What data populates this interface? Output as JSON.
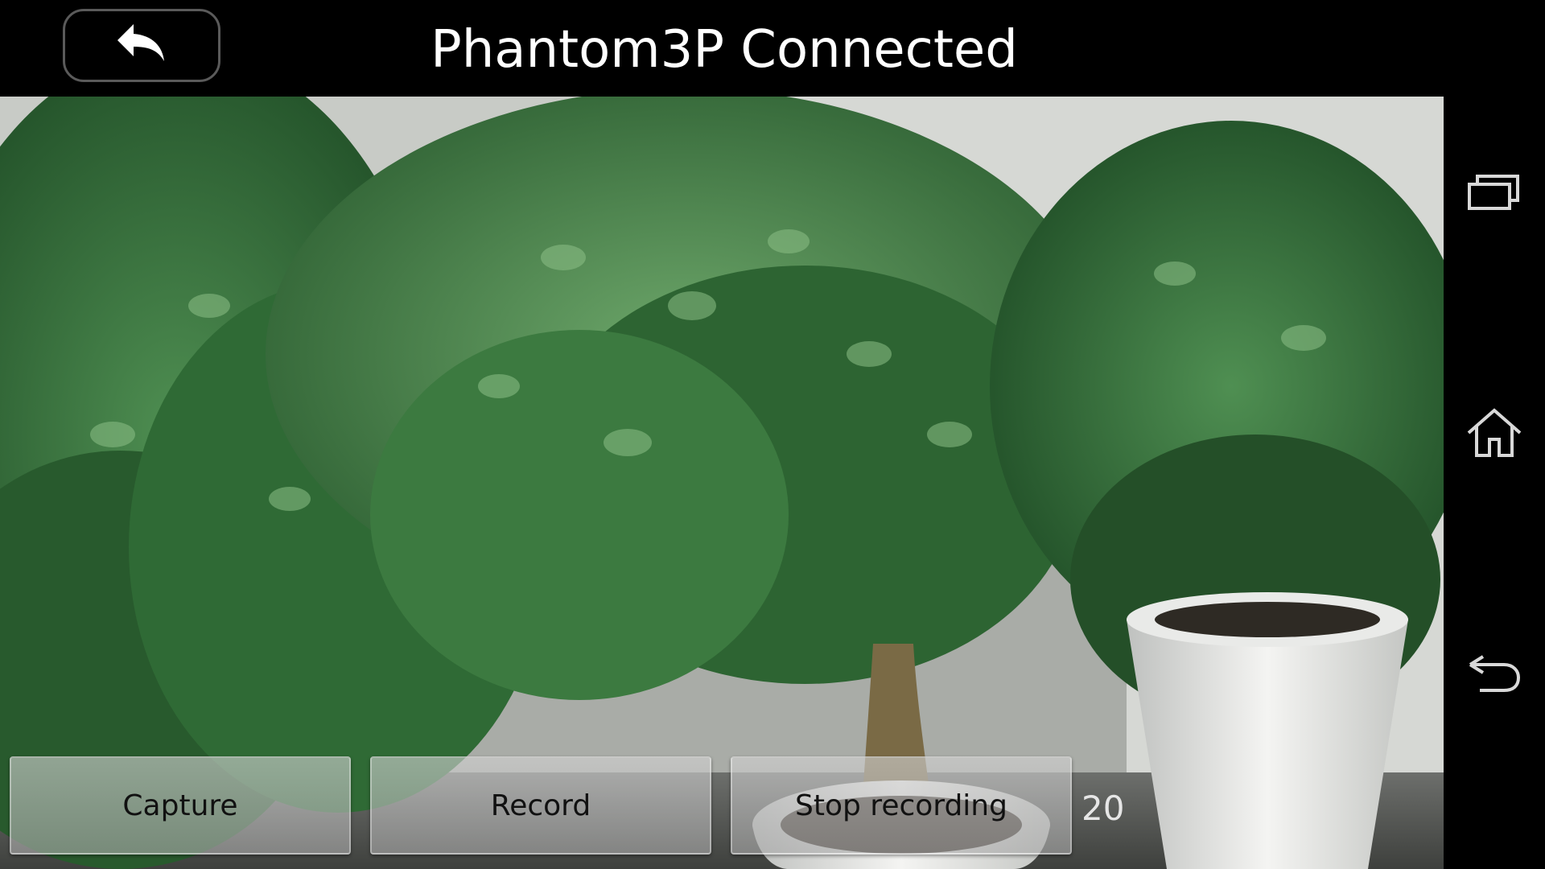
{
  "header": {
    "title": "Phantom3P Connected",
    "back_icon": "back-arrow-icon"
  },
  "controls": {
    "capture_label": "Capture",
    "record_label": "Record",
    "stop_label": "Stop recording",
    "counter": "20"
  },
  "navigation": {
    "recents_icon": "recent-apps-icon",
    "home_icon": "home-icon",
    "back_icon": "back-icon"
  },
  "preview": {
    "scene": "camera-feed"
  }
}
